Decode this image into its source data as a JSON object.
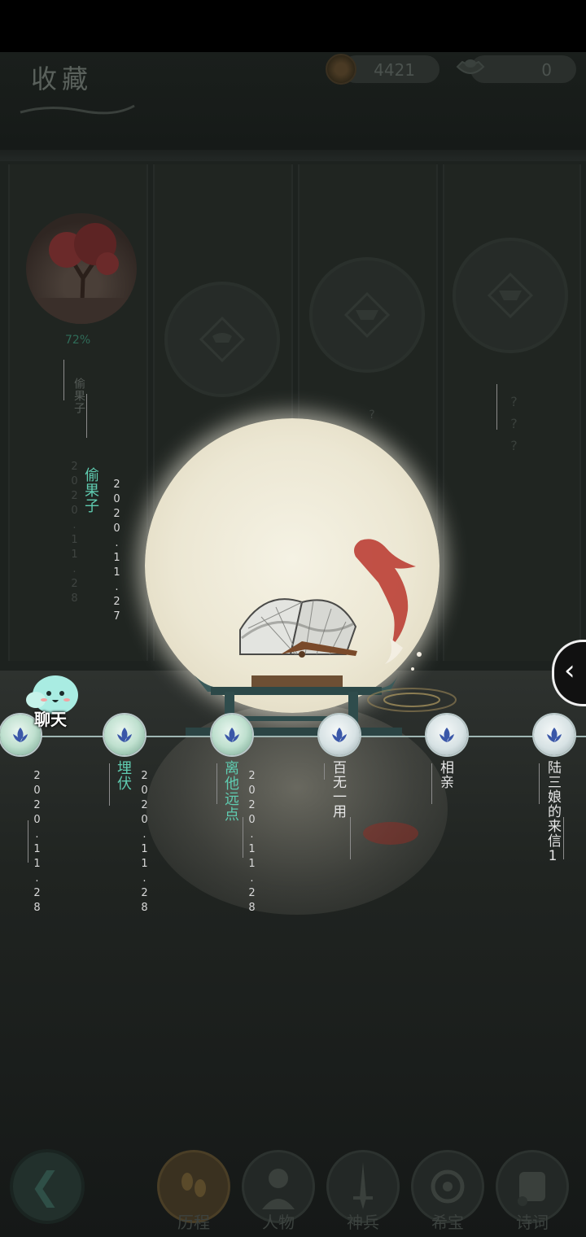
{
  "header": {
    "title": "收藏",
    "coins": "4421",
    "ingots": "0"
  },
  "cards": [
    {
      "name": "偷果子",
      "progress": "72%",
      "unlocked": true
    },
    {
      "name": "",
      "unlocked": false
    },
    {
      "name": "?",
      "unlocked": false
    },
    {
      "name": "???",
      "unlocked": false
    }
  ],
  "top_entry": {
    "title": "偷果子",
    "date_a": "2020.11.28",
    "date_b": "2020.11.27"
  },
  "chat": {
    "label": "聊天"
  },
  "timeline": [
    {
      "title": "",
      "date": "2020.11.28",
      "style": "green"
    },
    {
      "title": "埋伏",
      "date": "2020.11.28",
      "style": "green"
    },
    {
      "title": "离他远点",
      "date": "2020.11.28",
      "style": "green"
    },
    {
      "title": "百无一用",
      "date": "",
      "style": "white"
    },
    {
      "title": "相亲",
      "date": "",
      "style": "white"
    },
    {
      "title": "陆三娘的来信1",
      "date": "",
      "style": "white"
    }
  ],
  "bottom_nav": [
    {
      "label": "历程",
      "icon": "footprints-icon",
      "active": true
    },
    {
      "label": "人物",
      "icon": "character-icon",
      "active": false
    },
    {
      "label": "神兵",
      "icon": "weapon-icon",
      "active": false
    },
    {
      "label": "希宝",
      "icon": "treasure-icon",
      "active": false
    },
    {
      "label": "诗词",
      "icon": "scroll-icon",
      "active": false
    }
  ]
}
